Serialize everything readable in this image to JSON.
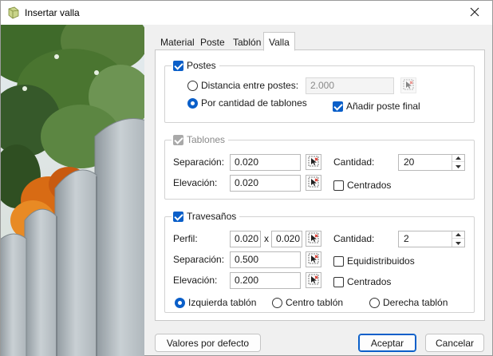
{
  "window": {
    "title": "Insertar valla",
    "close_icon": "close-icon",
    "app_icon": "fence-app-icon"
  },
  "tabs": [
    {
      "label": "Material",
      "active": false
    },
    {
      "label": "Poste",
      "active": false
    },
    {
      "label": "Tablón",
      "active": false
    },
    {
      "label": "Valla",
      "active": true
    }
  ],
  "postes": {
    "label": "Postes",
    "checked": true,
    "distance_option": "Distancia entre postes:",
    "distance_value": "2.000",
    "count_option": "Por cantidad de tablones",
    "selected_option": "count",
    "final_post_label": "Añadir poste final",
    "final_post_checked": true
  },
  "tablones": {
    "label": "Tablones",
    "checked": true,
    "enabled": false,
    "separation_label": "Separación:",
    "separation_value": "0.020",
    "elevation_label": "Elevación:",
    "elevation_value": "0.020",
    "quantity_label": "Cantidad:",
    "quantity_value": "20",
    "centered_label": "Centrados",
    "centered_checked": false
  },
  "travesanos": {
    "label": "Travesaños",
    "checked": true,
    "profile_label": "Perfil:",
    "profile_width": "0.020",
    "profile_x": "x",
    "profile_height": "0.020",
    "quantity_label": "Cantidad:",
    "quantity_value": "2",
    "separation_label": "Separación:",
    "separation_value": "0.500",
    "distributed_label": "Equidistribuidos",
    "distributed_checked": false,
    "elevation_label": "Elevación:",
    "elevation_value": "0.200",
    "centered_label": "Centrados",
    "centered_checked": false,
    "position_left": "Izquierda tablón",
    "position_center": "Centro tablón",
    "position_right": "Derecha tablón",
    "position_selected": "left"
  },
  "buttons": {
    "defaults": "Valores por defecto",
    "accept": "Aceptar",
    "cancel": "Cancelar"
  },
  "colors": {
    "accent": "#0a5fc9",
    "picker_red": "#d93025"
  }
}
